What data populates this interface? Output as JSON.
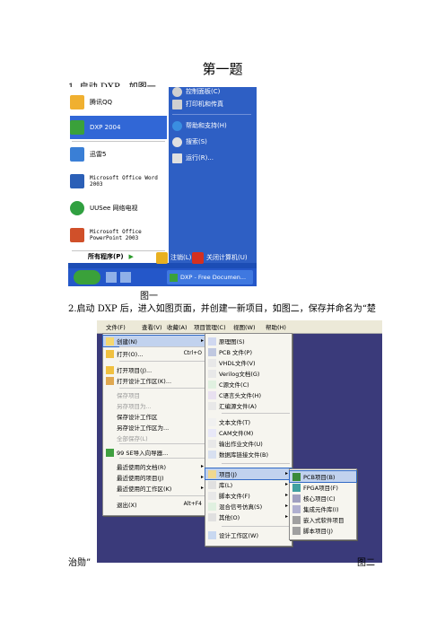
{
  "title": "第一题",
  "step1": "1..启动 DXP，如图一",
  "caption1": "图一",
  "step2_line1": "2.启动 DXP 后，进入如图页面，并创建一新项目，如图二，保存并命名为“楚",
  "step2_line2": "治勋”",
  "caption2": "图二",
  "startmenu": {
    "left_items": [
      {
        "label": "腾讯QQ",
        "color": "#f0b030"
      },
      {
        "label": "DXP 2004",
        "color": "#3aa13a"
      },
      {
        "label": "迅雷5",
        "color": "#3a7fd6"
      },
      {
        "label": "Microsoft Office Word 2003",
        "color": "#2b5fb7"
      },
      {
        "label": "UUSee 网络电视",
        "color": "#30a040"
      },
      {
        "label": "Microsoft Office PowerPoint 2003",
        "color": "#d0502a"
      }
    ],
    "all_programs": "所有程序(P)",
    "right_items": [
      {
        "label": "控制面板(C)",
        "color": "#d0d0d0"
      },
      {
        "label": "打印机和传真",
        "color": "#d0d0d0"
      },
      {
        "label": "帮助和支持(H)",
        "color": "#3a8ee0"
      },
      {
        "label": "搜索(S)",
        "color": "#e0e0e0"
      },
      {
        "label": "运行(R)...",
        "color": "#e0e0e0"
      }
    ],
    "logoff": "注销(L)",
    "shutdown": "关闭计算机(U)",
    "taskbar_item": "DXP - Free Documen..."
  },
  "dxp": {
    "menubar": [
      "文件(F)",
      "查看(V)",
      "收藏(A)",
      "项目管理(C)",
      "视图(W)",
      "帮助(H)"
    ],
    "file_menu": [
      {
        "label": "创建(N)",
        "arrow": "▸"
      },
      {
        "label": "打开(O)...",
        "shortcut": "Ctrl+O"
      },
      {
        "label": "打开项目(J)..."
      },
      {
        "label": "打开设计工作区(K)..."
      },
      {
        "label": "保存项目"
      },
      {
        "label": "另存项目为..."
      },
      {
        "label": "保存设计工作区"
      },
      {
        "label": "另存设计工作区为..."
      },
      {
        "label": "全部保存(L)"
      },
      {
        "label": "99 SE导入向导器..."
      },
      {
        "label": "最近使用的文档(R)",
        "arrow": "▸"
      },
      {
        "label": "最近使用的项目(J)",
        "arrow": "▸"
      },
      {
        "label": "最近使用的工作区(K)",
        "arrow": "▸"
      },
      {
        "label": "退出(X)",
        "shortcut": "Alt+F4"
      }
    ],
    "create_menu": [
      "原理图(S)",
      "PCB 文件(P)",
      "VHDL文件(V)",
      "Verilog文档(G)",
      "C源文件(C)",
      "C语言头文件(H)",
      "汇编源文件(A)",
      "文本文件(T)",
      "CAM文件(M)",
      "输出作业文件(U)",
      "数据库链接文件(B)",
      "项目(J)",
      "库(L)",
      "脚本文件(F)",
      "混合信号仿真(S)",
      "其他(O)",
      "设计工作区(W)"
    ],
    "project_menu": [
      "PCB项目(B)",
      "FPGA项目(F)",
      "核心项目(C)",
      "集成元件库(I)",
      "嵌入式软件项目",
      "脚本项目(J)"
    ]
  }
}
